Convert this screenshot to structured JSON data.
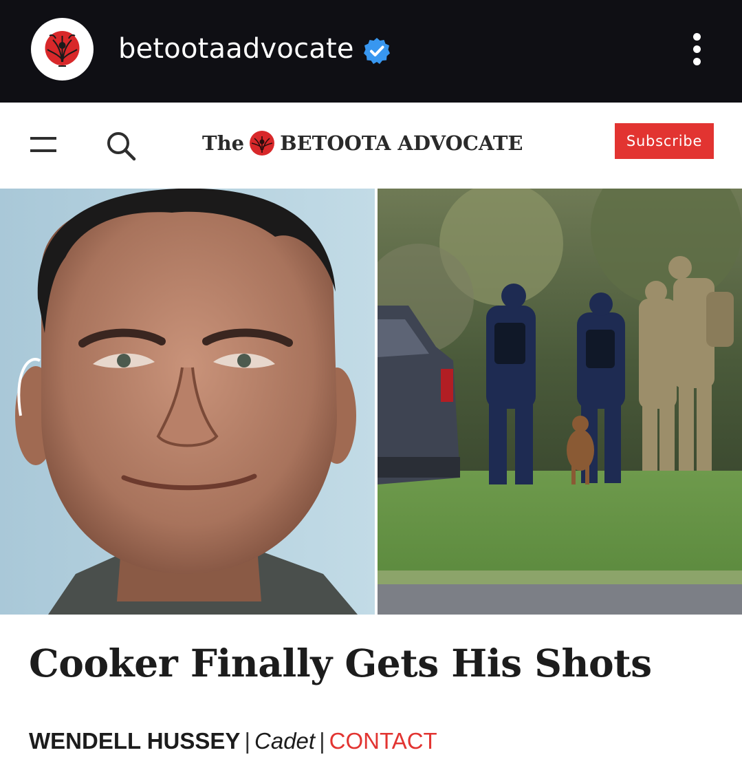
{
  "instagram": {
    "username": "betootaadvocate",
    "verified_icon": "verified-badge-icon",
    "more_icon": "more-options-icon",
    "verified_color": "#3897f0"
  },
  "site": {
    "brand_prefix": "The",
    "brand_name": "BETOOTA ADVOCATE",
    "subscribe_label": "Subscribe",
    "accent_color": "#e23431",
    "menu_icon": "hamburger-menu-icon",
    "search_icon": "search-icon"
  },
  "article": {
    "headline": "Cooker Finally Gets His Shots",
    "author": "WENDELL HUSSEY",
    "separator": "|",
    "role": "Cadet",
    "contact_label": "CONTACT"
  }
}
